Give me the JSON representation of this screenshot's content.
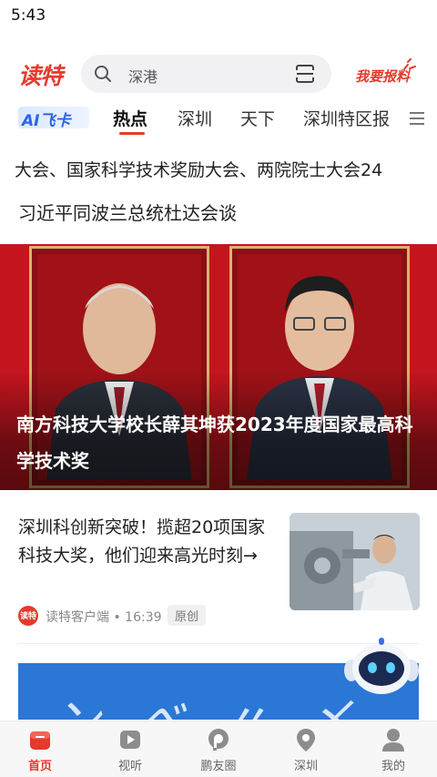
{
  "status_bar": {
    "time": "5:43"
  },
  "header": {
    "logo_text": "读特",
    "search_placeholder": "深港",
    "report_label": "我要报料"
  },
  "tabs": {
    "ai_label": "AI飞卡",
    "items": [
      "热点",
      "深圳",
      "天下",
      "深圳特区报"
    ],
    "active_index": 0
  },
  "ticker": {
    "text": "大会、国家科学技术奖励大会、两院院士大会24"
  },
  "headline": {
    "text": "习近平同波兰总统杜达会谈"
  },
  "hero": {
    "caption": "南方科技大学校长薛其坤获2023年度国家最高科学技术奖"
  },
  "article": {
    "title": "深圳科创新突破！揽超20项国家科技大奖，他们迎来高光时刻→",
    "source_logo_text": "读特",
    "source": "读特客户端 • 16:39",
    "badge": "原创"
  },
  "bottom_nav": {
    "items": [
      {
        "label": "首页",
        "icon": "home-icon",
        "active": true
      },
      {
        "label": "视听",
        "icon": "video-icon",
        "active": false
      },
      {
        "label": "鹏友圈",
        "icon": "community-icon",
        "active": false
      },
      {
        "label": "深圳",
        "icon": "location-icon",
        "active": false
      },
      {
        "label": "我的",
        "icon": "profile-icon",
        "active": false
      }
    ]
  },
  "colors": {
    "brand_red": "#e53a2b",
    "ai_blue": "#2b64e8",
    "hero_red": "#c4151f",
    "banner_blue": "#2a77d6"
  }
}
